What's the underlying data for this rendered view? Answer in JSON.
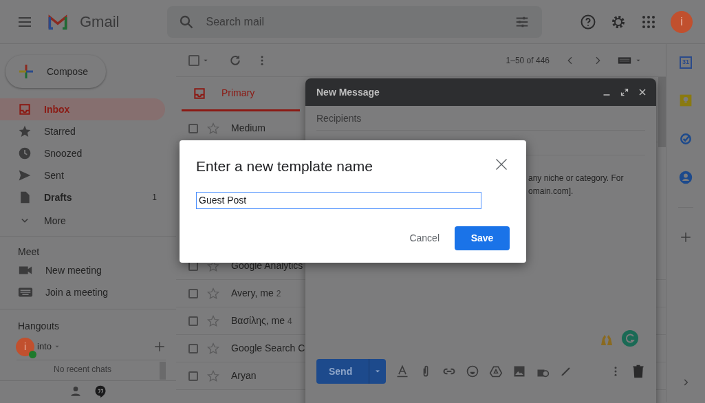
{
  "header": {
    "app_name": "Gmail",
    "search_placeholder": "Search mail",
    "avatar_letter": "i"
  },
  "compose_button": "Compose",
  "sidebar": {
    "items": [
      {
        "label": "Inbox",
        "kind": "inbox",
        "selected": true,
        "unread": true
      },
      {
        "label": "Starred",
        "kind": "star",
        "selected": false,
        "unread": false
      },
      {
        "label": "Snoozed",
        "kind": "clock",
        "selected": false,
        "unread": false
      },
      {
        "label": "Sent",
        "kind": "send",
        "selected": false,
        "unread": false
      },
      {
        "label": "Drafts",
        "kind": "draft",
        "selected": false,
        "unread": true,
        "count": "1"
      },
      {
        "label": "More",
        "kind": "more",
        "selected": false,
        "unread": false
      }
    ]
  },
  "meet": {
    "title": "Meet",
    "items": [
      {
        "label": "New meeting",
        "kind": "video"
      },
      {
        "label": "Join a meeting",
        "kind": "keyboard"
      }
    ]
  },
  "hangouts": {
    "title": "Hangouts",
    "user": {
      "letter": "i",
      "name": "into",
      "online": true
    },
    "empty_text": "No recent chats"
  },
  "toolbar": {
    "range": "1–50 of 446",
    "select_all_checked": false
  },
  "tabs": [
    {
      "label": "Primary",
      "selected": true
    }
  ],
  "emails": [
    {
      "sender": "Medium",
      "starred": false,
      "checked": false
    },
    {
      "sender": "Google Analytics",
      "starred": false,
      "checked": false
    },
    {
      "sender": "Avery, me",
      "count": "2",
      "starred": false,
      "checked": false
    },
    {
      "sender": "Βασίλης, me",
      "count": "4",
      "starred": false,
      "checked": false
    },
    {
      "sender": "Google Search C",
      "starred": false,
      "checked": false
    },
    {
      "sender": "Aryan",
      "starred": false,
      "checked": false
    }
  ],
  "compose": {
    "title": "New Message",
    "recipients_placeholder": "Recipients",
    "body_lines": [
      "any niche or category. For",
      "omain.com]."
    ],
    "send": "Send"
  },
  "right_rail": {
    "calendar_day": "31"
  },
  "dialog": {
    "title": "Enter a new template name",
    "value": "Guest Post",
    "cancel": "Cancel",
    "save": "Save"
  }
}
